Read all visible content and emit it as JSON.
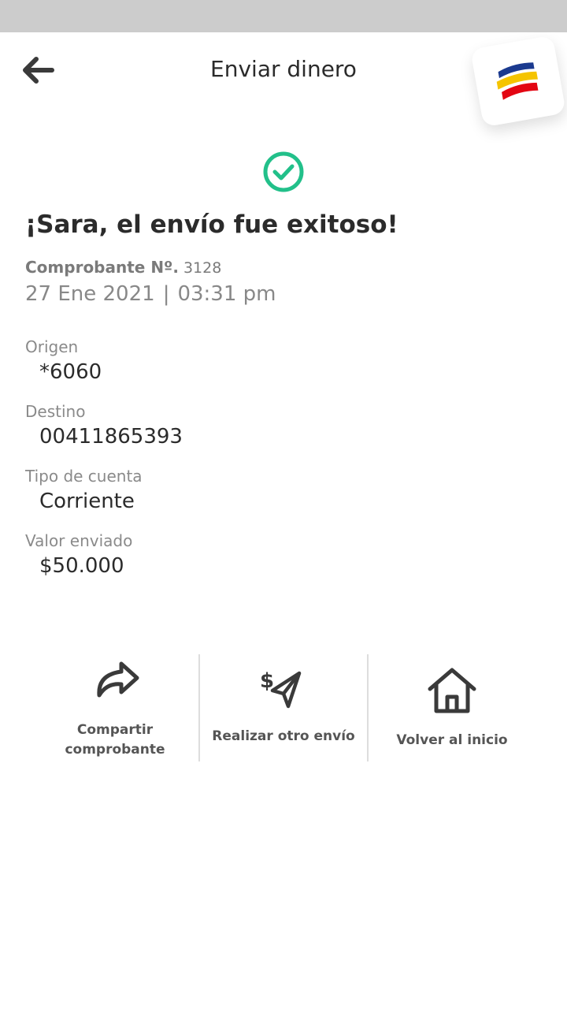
{
  "header": {
    "title": "Enviar dinero",
    "back_icon": "arrow-left-icon",
    "logo_icon": "bank-logo-icon",
    "logo_colors": [
      "#1b3a8f",
      "#f5c400",
      "#e30613"
    ]
  },
  "success": {
    "icon": "check-circle-icon",
    "icon_color": "#22c08a",
    "title": "¡Sara, el envío fue exitoso!"
  },
  "receipt": {
    "label": "Comprobante Nº.",
    "number": "3128",
    "date": "27 Ene 2021",
    "separator": "|",
    "time": "03:31 pm"
  },
  "details": [
    {
      "label": "Origen",
      "value": "*6060"
    },
    {
      "label": "Destino",
      "value": "00411865393"
    },
    {
      "label": "Tipo de cuenta",
      "value": "Corriente"
    },
    {
      "label": "Valor enviado",
      "value": "$50.000"
    }
  ],
  "actions": [
    {
      "icon": "share-icon",
      "label_line1": "Compartir",
      "label_line2": "comprobante"
    },
    {
      "icon": "send-money-icon",
      "label": "Realizar otro envío"
    },
    {
      "icon": "home-icon",
      "label": "Volver al inicio"
    }
  ]
}
